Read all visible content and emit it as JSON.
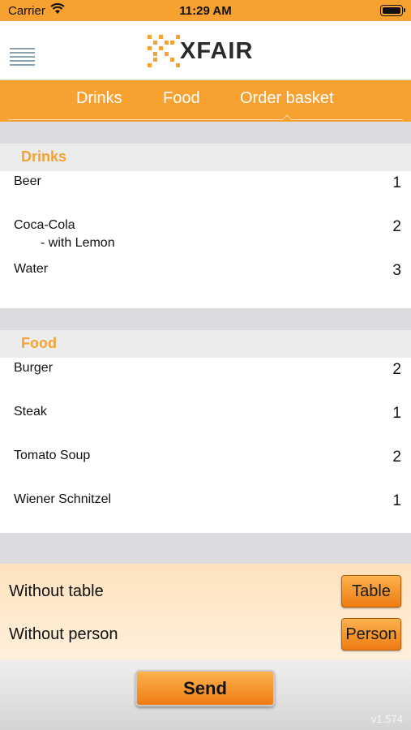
{
  "status_bar": {
    "carrier": "Carrier",
    "time": "11:29 AM"
  },
  "header": {
    "logo_text": "XFAIR"
  },
  "tabs": [
    {
      "label": "Drinks"
    },
    {
      "label": "Food"
    },
    {
      "label": "Order basket",
      "selected": true
    }
  ],
  "sections": {
    "drinks": {
      "title": "Drinks",
      "items": [
        {
          "name": "Beer",
          "qty": "1"
        },
        {
          "name": "Coca-Cola",
          "sub": "- with Lemon",
          "qty": "2"
        },
        {
          "name": "Water",
          "qty": "3"
        }
      ]
    },
    "food": {
      "title": "Food",
      "items": [
        {
          "name": "Burger",
          "qty": "2"
        },
        {
          "name": "Steak",
          "qty": "1"
        },
        {
          "name": "Tomato Soup",
          "qty": "2"
        },
        {
          "name": "Wiener Schnitzel",
          "qty": "1"
        }
      ]
    }
  },
  "controls": {
    "table_label": "Without table",
    "table_button": "Table",
    "person_label": "Without person",
    "person_button": "Person"
  },
  "footer": {
    "send_label": "Send",
    "version": "v1.574"
  },
  "colors": {
    "accent": "#f7a130",
    "button_gradient_top": "#fbb24e",
    "button_gradient_bottom": "#ee7c12"
  }
}
